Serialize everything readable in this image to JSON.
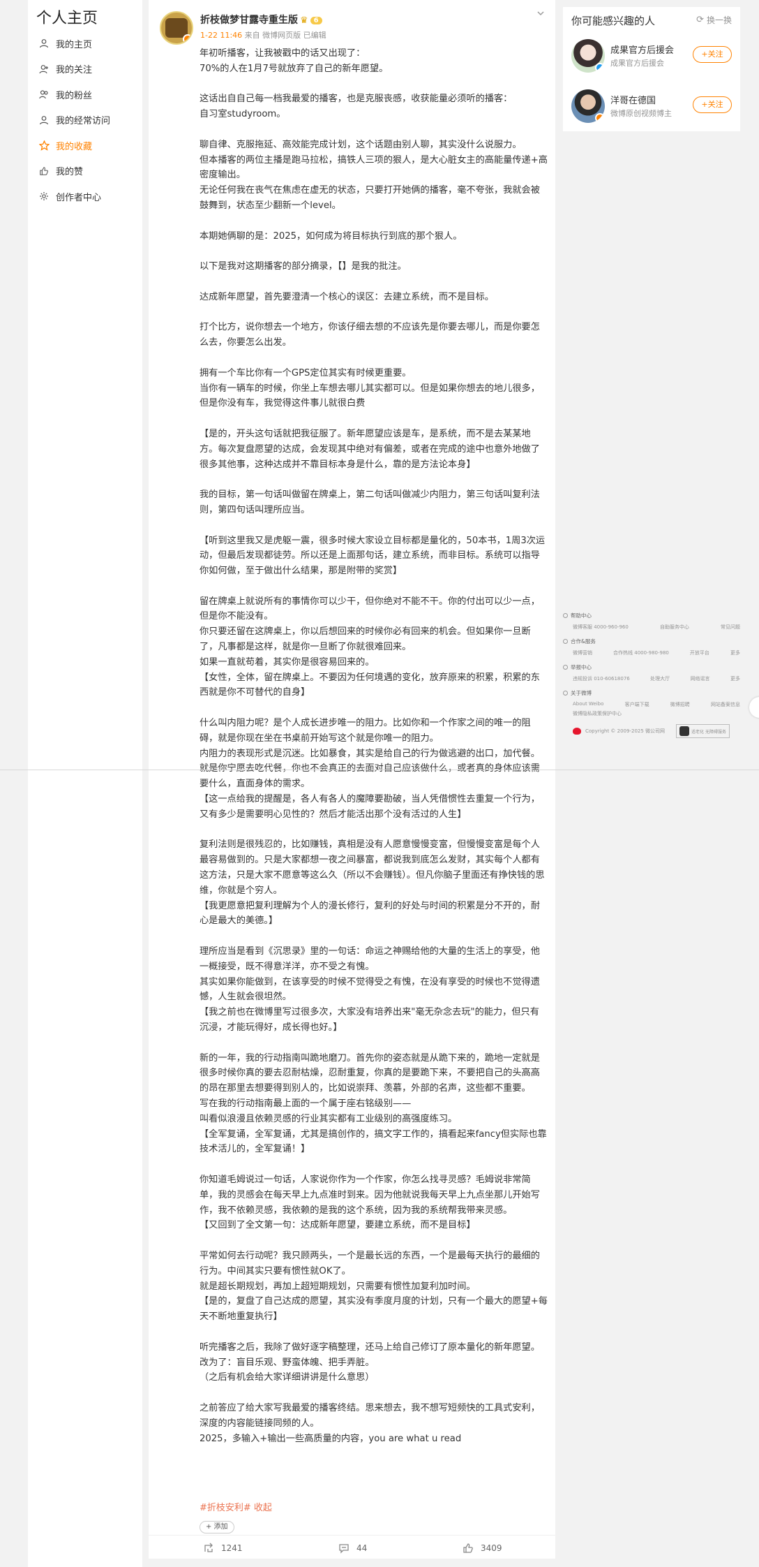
{
  "sidebar": {
    "title": "个人主页",
    "items": [
      {
        "label": "我的主页",
        "icon": "user-icon"
      },
      {
        "label": "我的关注",
        "icon": "follow-icon"
      },
      {
        "label": "我的粉丝",
        "icon": "fans-icon"
      },
      {
        "label": "我的经常访问",
        "icon": "visit-icon"
      },
      {
        "label": "我的收藏",
        "icon": "star-icon",
        "active": true
      },
      {
        "label": "我的赞",
        "icon": "like-icon"
      },
      {
        "label": "创作者中心",
        "icon": "gear-icon"
      }
    ]
  },
  "post": {
    "author": "折枝做梦甘露寺重生版",
    "level_badge": "6",
    "date": "1-22 11:46",
    "source": "来自 微博网页版",
    "edited": "已编辑",
    "paragraphs": [
      "年初听播客，让我被戳中的话又出现了：",
      "70%的人在1月7号就放弃了自己的新年愿望。",
      "",
      "这话出自自己每一档我最爱的播客，也是克服丧感，收获能量必须听的播客：",
      "自习室studyroom。",
      "",
      "聊自律、克服拖延、高效能完成计划，这个话题由别人聊，其实没什么说服力。",
      "但本播客的两位主播是跑马拉松，搞铁人三项的狠人，是大心脏女主的高能量传递+高密度输出。",
      "无论任何我在丧气在焦虑在虚无的状态，只要打开她俩的播客，毫不夸张，我就会被鼓舞到，状态至少翻新一个level。",
      "",
      "本期她俩聊的是：2025，如何成为将目标执行到底的那个狠人。",
      "",
      "以下是我对这期播客的部分摘录，【】是我的批注。",
      "",
      "达成新年愿望，首先要澄清一个核心的误区：去建立系统，而不是目标。",
      "",
      "打个比方，说你想去一个地方，你该仔细去想的不应该先是你要去哪儿，而是你要怎么去，你要怎么出发。",
      "",
      "拥有一个车比你有一个GPS定位其实有时候更重要。",
      "当你有一辆车的时候，你坐上车想去哪儿其实都可以。但是如果你想去的地儿很多，但是你没有车，我觉得这件事儿就很白费",
      "",
      "【是的，开头这句话就把我征服了。新年愿望应该是车，是系统，而不是去某某地方。每次复盘愿望的达成，会发现其中绝对有偏差，或者在完成的途中也意外地做了很多其他事，这种达成并不靠目标本身是什么，靠的是方法论本身】",
      "",
      "我的目标，第一句话叫做留在牌桌上，第二句话叫做减少内阻力，第三句话叫复利法则，第四句话叫理所应当。",
      "",
      "【听到这里我又是虎躯一震，很多时候大家设立目标都是量化的，50本书，1周3次运动，但最后发现都徒劳。所以还是上面那句话，建立系统，而非目标。系统可以指导你如何做，至于做出什么结果，那是附带的奖赏】",
      "",
      "留在牌桌上就说所有的事情你可以少干，但你绝对不能不干。你的付出可以少一点，但是你不能没有。",
      "你只要还留在这牌桌上，你以后想回来的时候你必有回来的机会。但如果你一旦断了，凡事都是这样，就是你一旦断了你就很难回来。",
      "如果一直就苟着，其实你是很容易回来的。",
      "【女性，全体，留在牌桌上。不要因为任何境遇的变化，放弃原来的积累，积累的东西就是你不可替代的自身】",
      "",
      "什么叫内阻力呢？是个人成长进步唯一的阻力。比如你和一个作家之间的唯一的阻碍，就是你现在坐在书桌前开始写这个就是你唯一的阻力。",
      "内阻力的表现形式是沉迷。比如暴食，其实是给自己的行为做逃避的出口，加代餐。就是你宁愿去吃代餐，你也不会真正的去面对自己应该做什么，或者真的身体应该需要什么，直面身体的需求。",
      "【这一点给我的提醒是，各人有各人的魔障要勘破，当人凭借惯性去重复一个行为，又有多少是需要明心见性的？然后才能活出那个没有活过的人生】",
      "",
      "复利法则是很残忍的，比如赚钱，真相是没有人愿意慢慢变富，但慢慢变富是每个人最容易做到的。只是大家都想一夜之间暴富，都说我到底怎么发财，其实每个人都有这方法，只是大家不愿意等这么久（所以不会赚钱）。但凡你脑子里面还有挣快钱的思维，你就是个穷人。",
      "【我更愿意把复利理解为个人的漫长修行，复利的好处与时间的积累是分不开的，耐心是最大的美德。】",
      "",
      "理所应当是看到《沉思录》里的一句话：命运之神赐给他的大量的生活上的享受，他一概接受，既不得意洋洋，亦不受之有愧。",
      "其实如果你能做到，在该享受的时候不觉得受之有愧，在没有享受的时候也不觉得遗憾，人生就会很坦然。",
      "【我之前也在微博里写过很多次，大家没有培养出来\"毫无杂念去玩\"的能力，但只有沉浸，才能玩得好，成长得也好。】",
      "",
      "新的一年，我的行动指南叫跪地磨刀。首先你的姿态就是从跪下来的，跪地一定就是很多时候你真的要去忍耐枯燥，忍耐重复，你真的是要跪下来，不要把自己的头高高的昂在那里去想要得到别人的，比如说崇拜、羡慕，外部的名声，这些都不重要。",
      "写在我的行动指南最上面的一个属于座右铭级别——",
      "叫看似浪漫且依赖灵感的行业其实都有工业级别的高强度练习。",
      "【全军复诵，全军复诵，尤其是搞创作的，搞文字工作的，搞看起来fancy但实际也靠技术活儿的，全军复诵！】",
      "",
      "你知道毛姆说过一句话，人家说你作为一个作家，你怎么找寻灵感？毛姆说非常简单，我的灵感会在每天早上九点准时到来。因为他就说我每天早上九点坐那儿开始写作，我不依赖灵感，我依赖的是我的这个系统，因为我的系统帮我带来灵感。",
      "【又回到了全文第一句：达成新年愿望，要建立系统，而不是目标】",
      "",
      "平常如何去行动呢？我只顾两头，一个是最长远的东西，一个是最每天执行的最细的行为。中间其实只要有惯性就OK了。",
      "就是超长期规划，再加上超短期规划，只需要有惯性加复利加时间。",
      "【是的，复盘了自己达成的愿望，其实没有季度月度的计划，只有一个最大的愿望+每天不断地重复执行】",
      "",
      "听完播客之后，我除了做好逐字稿整理，还马上给自己修订了原本量化的新年愿望。",
      "改为了：盲目乐观、野蛮体魄、把手弄脏。",
      "（之后有机会给大家详细讲讲是什么意思）",
      "",
      "之前答应了给大家写我最爱的播客终结。思来想去，我不想写短频快的工具式安利，深度的内容能链接同频的人。",
      "2025，多输入+输出一些高质量的内容，you are what u read"
    ],
    "tags": "#折枝安利# 收起",
    "add_tag": "+ 添加",
    "reposts": "1241",
    "comments": "44",
    "likes": "3409"
  },
  "recommend": {
    "title": "你可能感兴趣的人",
    "swap_label": "换一换",
    "users": [
      {
        "name": "成果官方后援会",
        "desc": "成果官方后援会",
        "follow": "+关注"
      },
      {
        "name": "洋哥在德国",
        "desc": "微博原创视频博主",
        "follow": "+关注"
      }
    ]
  },
  "footer": {
    "sections": [
      {
        "title": "帮助中心",
        "rows": [
          [
            "微博客服 4000-960-960",
            "自助服务中心",
            "常见问题"
          ]
        ]
      },
      {
        "title": "合作&服务",
        "rows": [
          [
            "微博营销",
            "合作热线 4000-980-980",
            "开放平台",
            "更多"
          ]
        ]
      },
      {
        "title": "举报中心",
        "rows": [
          [
            "违规投诉 010-60618076",
            "处理大厅",
            "网络谣言",
            "更多"
          ]
        ]
      },
      {
        "title": "关于微博",
        "rows": [
          [
            "About Weibo",
            "客户端下载",
            "微博招聘",
            "网站备案信息"
          ],
          [
            "微博隐私政策保护中心"
          ]
        ]
      }
    ],
    "copyright": "Copyright © 2009-2025 微公司网",
    "elder_label": "适老化 无障碍服务"
  }
}
